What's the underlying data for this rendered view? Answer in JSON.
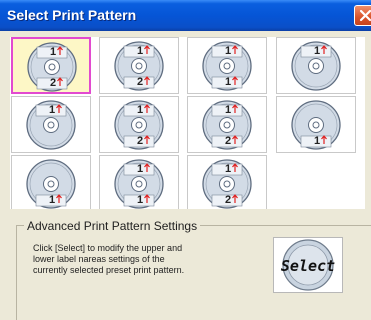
{
  "window": {
    "title": "Select Print Pattern",
    "close_icon": "close-x-icon"
  },
  "patterns": [
    {
      "top": "1",
      "bottom": "2"
    },
    {
      "top": "1",
      "bottom": "2"
    },
    {
      "top": "1",
      "bottom": "1"
    },
    {
      "top": "1",
      "bottom": ""
    },
    {
      "top": "1",
      "bottom": ""
    },
    {
      "top": "1",
      "bottom": "2"
    },
    {
      "top": "1",
      "bottom": "2"
    },
    {
      "top": "",
      "bottom": "1"
    },
    {
      "top": "",
      "bottom": "1"
    },
    {
      "top": "1",
      "bottom": "1"
    },
    {
      "top": "1",
      "bottom": "2"
    }
  ],
  "selected_pattern": 1,
  "advanced": {
    "title": "Advanced Print Pattern Settings",
    "description_lines": [
      "Click [Select] to modify the upper and",
      "lower label nareas settings of the",
      "currently selected preset print pattern."
    ],
    "select_label": "Select"
  },
  "colors": {
    "titlebar": "#0655d6",
    "selected_border": "#e24ad0",
    "selected_fill": "#fdf7c6",
    "disc_fill": "#d2dbe6",
    "arrow_red": "#e02020"
  }
}
